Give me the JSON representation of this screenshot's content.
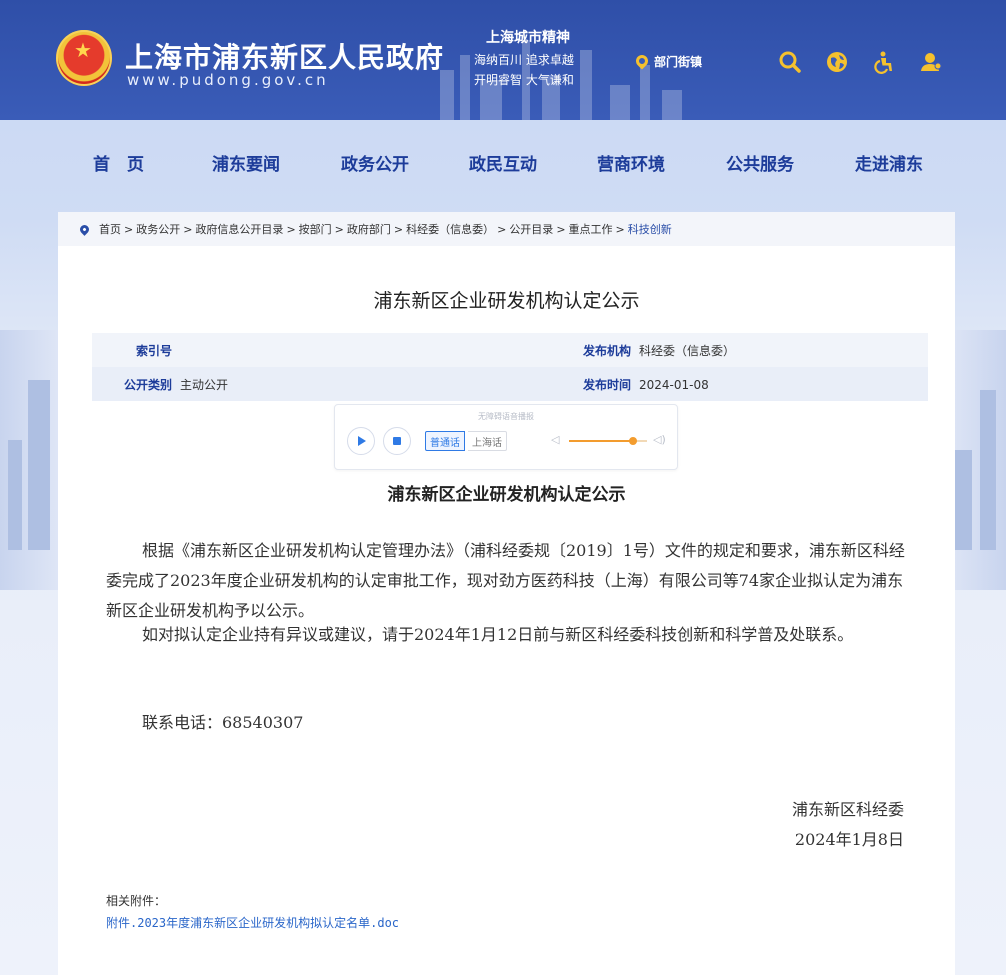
{
  "header": {
    "site_title": "上海市浦东新区人民政府",
    "site_url": "www.pudong.gov.cn",
    "spirit_title": "上海城市精神",
    "spirit_line1": "海纳百川  追求卓越",
    "spirit_line2": "开明睿智  大气谦和",
    "location_label": "部门街镇",
    "icons": [
      "search-icon",
      "globe-icon",
      "accessibility-icon",
      "user-icon"
    ]
  },
  "nav": {
    "items": [
      "首　页",
      "浦东要闻",
      "政务公开",
      "政民互动",
      "营商环境",
      "公共服务",
      "走进浦东"
    ]
  },
  "breadcrumb": {
    "items": [
      "首页",
      "政务公开",
      "政府信息公开目录",
      "按部门",
      "政府部门",
      "科经委（信息委）",
      "公开目录",
      "重点工作",
      "科技创新"
    ]
  },
  "page": {
    "title": "浦东新区企业研发机构认定公示"
  },
  "meta": {
    "index_key": "索引号",
    "index_val": "",
    "publisher_key": "发布机构",
    "publisher_val": "科经委（信息委）",
    "category_key": "公开类别",
    "category_val": "主动公开",
    "date_key": "发布时间",
    "date_val": "2024-01-08"
  },
  "player": {
    "note": "无障碍语音播报",
    "lang_a": "普通话",
    "lang_b": "上海话",
    "volume": 0.82
  },
  "article": {
    "title": "浦东新区企业研发机构认定公示",
    "p1": "根据《浦东新区企业研发机构认定管理办法》（浦科经委规〔2019〕1号）文件的规定和要求，浦东新区科经委完成了2023年度企业研发机构的认定审批工作，现对劲方医药科技（上海）有限公司等74家企业拟认定为浦东新区企业研发机构予以公示。",
    "p2": "如对拟认定企业持有异议或建议，请于2024年1月12日前与新区科经委科技创新和科学普及处联系。",
    "p3": "联系电话：68540307",
    "sign1": "浦东新区科经委",
    "sign2": "2024年1月8日",
    "attachment_label": "相关附件：",
    "attachment_link": "附件.2023年度浦东新区企业研发机构拟认定名单.doc"
  },
  "colors": {
    "header_bg": "#3a5cb8",
    "nav_text": "#1d3c9a",
    "accent_yellow": "#f5c12e",
    "link": "#2a66c9"
  }
}
